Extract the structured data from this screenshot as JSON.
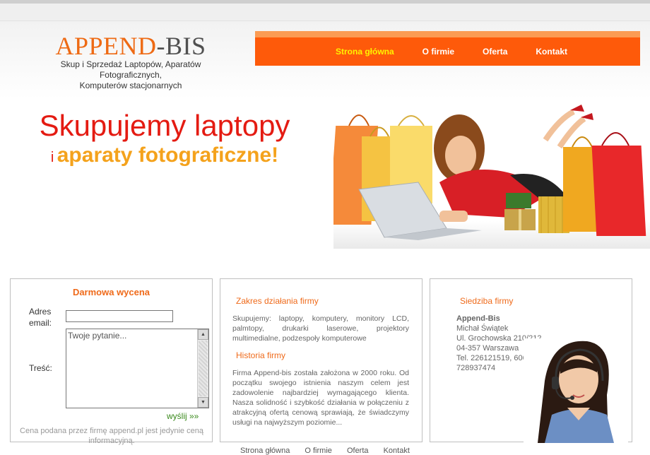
{
  "logo": {
    "part1": "APPEND",
    "part2": "-BIS",
    "subtitle_line1": "Skup i Sprzedaż Laptopów, Aparatów Fotograficznych,",
    "subtitle_line2": "Komputerów stacjonarnych"
  },
  "nav": {
    "items": [
      {
        "label": "Strona główna"
      },
      {
        "label": "O firmie"
      },
      {
        "label": "Oferta"
      },
      {
        "label": "Kontakt"
      }
    ]
  },
  "hero": {
    "line1": "Skupujemy laptopy",
    "line2_small": "i",
    "line2_big": "aparaty fotograficzne!"
  },
  "form": {
    "title": "Darmowa wycena",
    "email_label_1": "Adres",
    "email_label_2": "email:",
    "email_value": "",
    "message_label": "Treść:",
    "message_placeholder": "Twoje pytanie...",
    "send_label": "wyślij »»",
    "disclaimer": "Cena podana przez firmę append.pl jest jedynie ceną informacyjną."
  },
  "scope": {
    "title": "Zakres działania firmy",
    "text": "Skupujemy: laptopy, komputery, monitory LCD, palmtopy, drukarki laserowe, projektory multimedialne, podzespoły komputerowe",
    "history_title": "Historia firmy",
    "history_text": "Firma Append-bis została założona w 2000 roku. Od początku swojego istnienia naszym celem jest zadowolenie najbardziej wymagającego klienta. Nasza solidność i szybkość działania w połączeniu z atrakcyjną ofertą cenową sprawiają, że świadczymy usługi na najwyższym poziomie..."
  },
  "hq": {
    "title": "Siedziba firmy",
    "name": "Append-Bis",
    "person": "Michał Świątek",
    "street": "Ul. Grochowska 210/212",
    "city": "04-357 Warszawa",
    "phone1": "Tel. 226121519, 606",
    "phone2": "728937474"
  },
  "footer": {
    "items": [
      "Strona główna",
      "O firmie",
      "Oferta",
      "Kontakt"
    ]
  },
  "colors": {
    "accent": "#fe5a0a",
    "nav_top": "#fb9b53",
    "hero_red": "#e41b12",
    "hero_yellow": "#f4a21c",
    "active_nav": "#fff200"
  }
}
